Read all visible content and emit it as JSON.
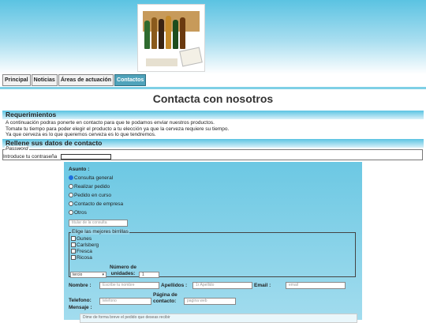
{
  "header": {
    "logo_alt": "beer-gift-box-image"
  },
  "nav": {
    "tabs": [
      "Principal",
      "Noticias",
      "Áreas de actuación",
      "Contactos"
    ],
    "active": "Contactos"
  },
  "page": {
    "title": "Contacta con nosotros"
  },
  "requirements": {
    "heading": "Requerimientos",
    "lines": [
      "A continuación podras ponerte en contacto para que te podamos enviar nuestros productos.",
      "Tomate tu tiempo para poder elegir el producto a tu elección ya que la cerveza requiere su tiempo.",
      "Ya que cerveza es lo que queremos cerveza es lo que tendremos."
    ]
  },
  "form_section": {
    "heading": "Rellene sus datos de contacto"
  },
  "password": {
    "legend": "Password",
    "label": "Introduce tu contraseña",
    "value": ""
  },
  "form": {
    "asunto_label": "Asunto :",
    "asunto_options": [
      "Consulta general",
      "Realizar pedido",
      "Pedido en curso",
      "Contacto de empresa",
      "Otros"
    ],
    "asunto_selected": "Consulta general",
    "titulo_placeholder": "titular de la consulta",
    "birras_legend": "Elige las mejores birrillas",
    "birras": [
      "Gunes",
      "Carlsberg",
      "Fresca",
      "Ricosa"
    ],
    "tipo_selected": "tercio",
    "unidades_label": "Número de unidades:",
    "unidades_value": "1",
    "nombre_label": "Nombre :",
    "nombre_placeholder": "Escribe tu nombre",
    "apellidos_label": "Apellidos :",
    "apellidos_placeholder": "1r Apellido",
    "email_label": "Email :",
    "email_placeholder": "email",
    "telefono_label": "Telefono:",
    "telefono_placeholder": "telefono",
    "pagina_label": "Página de contacto:",
    "pagina_placeholder": "pagina web",
    "mensaje_label": "Mensaje :",
    "mensaje_placeholder": "Dime de forma breve el pedido que deseas recibir"
  }
}
